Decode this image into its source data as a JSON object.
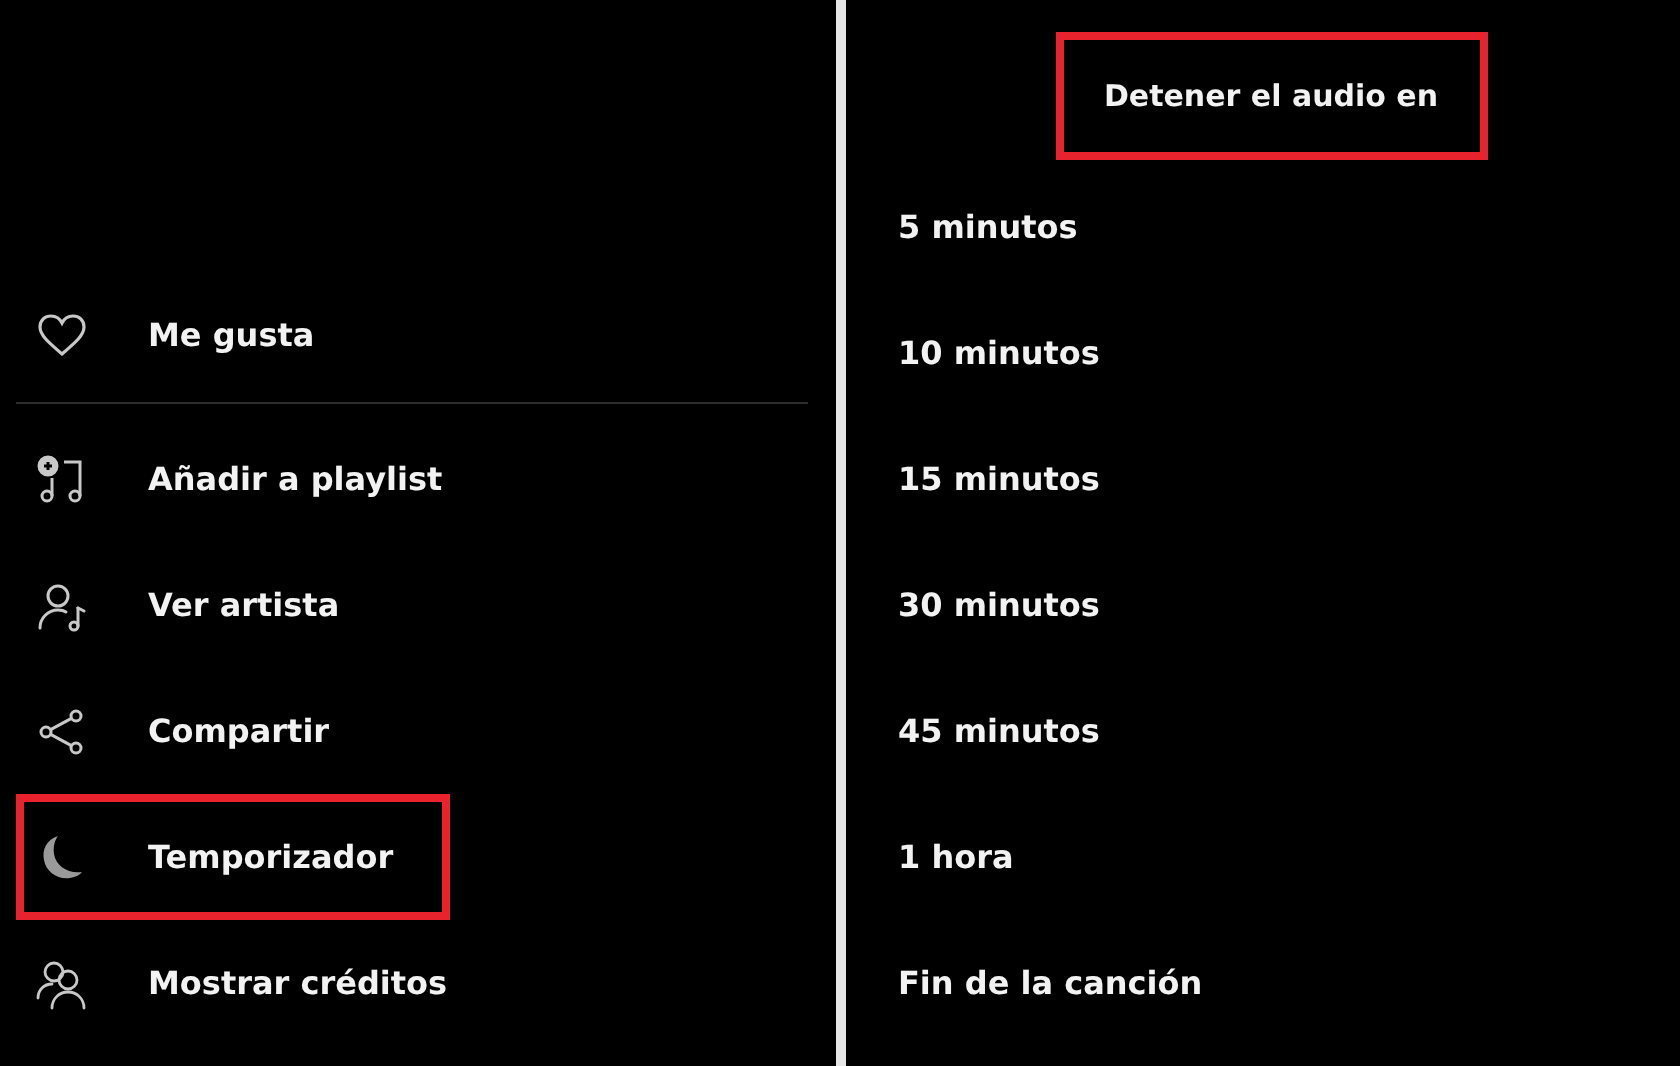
{
  "left_menu": {
    "items": [
      {
        "label": "Me gusta",
        "kind": "heart",
        "highlighted": false
      },
      {
        "label": "Añadir a playlist",
        "kind": "add-playlist",
        "highlighted": false
      },
      {
        "label": "Ver artista",
        "kind": "artist",
        "highlighted": false
      },
      {
        "label": "Compartir",
        "kind": "share",
        "highlighted": false
      },
      {
        "label": "Temporizador",
        "kind": "moon",
        "highlighted": true
      },
      {
        "label": "Mostrar créditos",
        "kind": "credits",
        "highlighted": false
      }
    ]
  },
  "sleep_timer": {
    "title": "Detener el audio en",
    "title_highlighted": true,
    "options": [
      {
        "label": "5 minutos"
      },
      {
        "label": "10 minutos"
      },
      {
        "label": "15 minutos"
      },
      {
        "label": "30 minutos"
      },
      {
        "label": "45 minutos"
      },
      {
        "label": "1 hora"
      },
      {
        "label": "Fin de la canción"
      }
    ]
  }
}
